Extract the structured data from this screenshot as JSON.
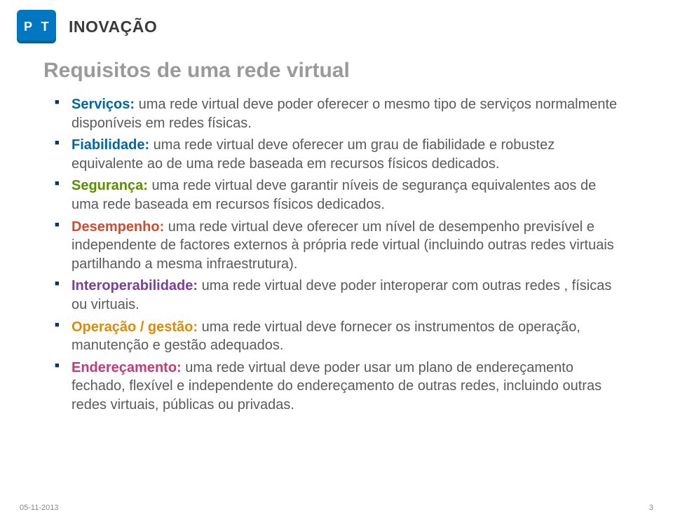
{
  "logo": {
    "p": "P",
    "t": "T",
    "word": "INOVAÇÃO"
  },
  "title": "Requisitos de uma rede virtual",
  "bullets": [
    {
      "kw": "Serviços:",
      "cls": "kw-blue",
      "text": " uma rede virtual deve poder oferecer  o mesmo tipo de serviços normalmente disponíveis em redes físicas."
    },
    {
      "kw": "Fiabilidade:",
      "cls": "kw-blue",
      "text": " uma rede virtual deve oferecer um grau de fiabilidade e robustez equivalente ao de uma rede baseada em recursos físicos dedicados."
    },
    {
      "kw": "Segurança:",
      "cls": "kw-green",
      "text": " uma rede virtual deve garantir níveis de segurança equivalentes aos de uma rede baseada em recursos físicos dedicados."
    },
    {
      "kw": "Desempenho:",
      "cls": "kw-red",
      "text": " uma rede virtual deve oferecer um nível de desempenho previsível e independente de factores externos à própria rede virtual (incluindo outras redes virtuais partilhando a mesma infraestrutura)."
    },
    {
      "kw": "Interoperabilidade:",
      "cls": "kw-purple",
      "text": " uma rede virtual deve poder interoperar com outras redes , físicas ou virtuais."
    },
    {
      "kw": "Operação / gestão:",
      "cls": "kw-orange",
      "text": " uma rede virtual deve fornecer os instrumentos de operação, manutenção e gestão adequados."
    },
    {
      "kw": "Endereçamento:",
      "cls": "kw-pink",
      "text": " uma rede virtual deve poder usar um plano de endereçamento fechado, flexível e independente do endereçamento de outras redes, incluindo outras redes virtuais, públicas ou privadas."
    }
  ],
  "footer": {
    "date": "05-11-2013",
    "page": "3"
  }
}
